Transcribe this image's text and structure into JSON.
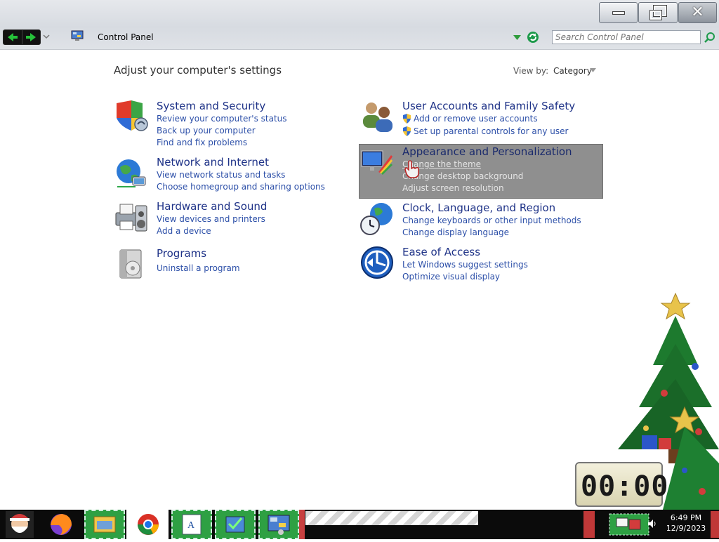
{
  "window": {
    "address": "Control Panel",
    "search_placeholder": "Search Control Panel",
    "controls": {
      "minimize": "minimize",
      "maximize": "restore",
      "close": "✕"
    }
  },
  "content": {
    "heading": "Adjust your computer's settings",
    "view_by_label": "View by:",
    "view_by_value": "Category"
  },
  "categories": {
    "system_security": {
      "title": "System and Security",
      "links": [
        "Review your computer's status",
        "Back up your computer",
        "Find and fix problems"
      ]
    },
    "network_internet": {
      "title": "Network and Internet",
      "links": [
        "View network status and tasks",
        "Choose homegroup and sharing options"
      ]
    },
    "hardware_sound": {
      "title": "Hardware and Sound",
      "links": [
        "View devices and printers",
        "Add a device"
      ]
    },
    "programs": {
      "title": "Programs",
      "links": [
        "Uninstall a program"
      ]
    },
    "user_accounts": {
      "title": "User Accounts and Family Safety",
      "links": [
        "Add or remove user accounts",
        "Set up parental controls for any user"
      ]
    },
    "appearance": {
      "title": "Appearance and Personalization",
      "links": [
        "Change the theme",
        "Change desktop background",
        "Adjust screen resolution"
      ]
    },
    "clock_region": {
      "title": "Clock, Language, and Region",
      "links": [
        "Change keyboards or other input methods",
        "Change display language"
      ]
    },
    "ease_access": {
      "title": "Ease of Access",
      "links": [
        "Let Windows suggest settings",
        "Optimize visual display"
      ]
    }
  },
  "desktop_widget": {
    "clock_text": "00:00"
  },
  "taskbar": {
    "time": "6:49 PM",
    "date": "12/9/2023",
    "icons": [
      "santa-icon",
      "firefox-icon",
      "file-explorer-icon",
      "chrome-icon",
      "wordpad-icon",
      "task-icon",
      "control-panel-icon"
    ]
  },
  "colors": {
    "link": "#2c4fa8",
    "title": "#1e3287",
    "highlight": "#8f8f8f",
    "taskbar": "#0b0b0b",
    "taskbar_green": "#2ea043"
  }
}
